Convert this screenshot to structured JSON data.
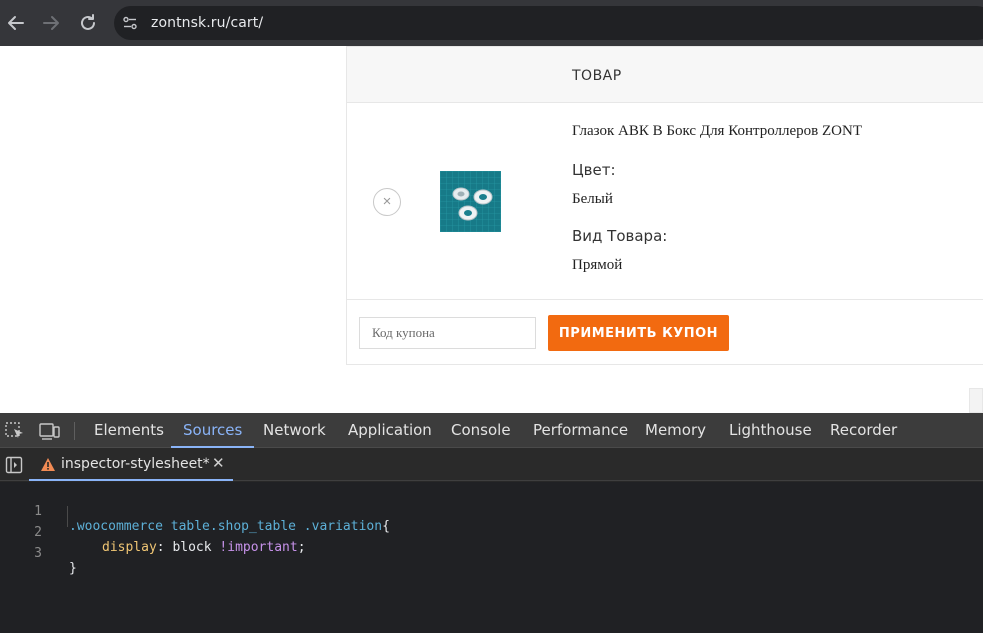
{
  "browser": {
    "url": "zontnsk.ru/cart/",
    "icons": [
      "back-arrow-icon",
      "forward-arrow-icon",
      "reload-icon",
      "site-settings-icon"
    ]
  },
  "cart": {
    "column_header": "ТОВАР",
    "item": {
      "name": "Глазок АВК В Бокс Для Контроллеров ZONT",
      "attributes": [
        {
          "label": "Цвет:",
          "value": "Белый"
        },
        {
          "label": "Вид Товара:",
          "value": "Прямой"
        }
      ],
      "remove_symbol": "×"
    },
    "coupon": {
      "placeholder": "Код купона",
      "button_label": "ПРИМЕНИТЬ КУПОН"
    },
    "colors": {
      "accent": "#f26a10",
      "header_bg": "#f7f7f7"
    }
  },
  "devtools": {
    "tabs": [
      "Elements",
      "Sources",
      "Network",
      "Application",
      "Console",
      "Performance",
      "Memory",
      "Lighthouse",
      "Recorder"
    ],
    "active_tab": "Sources",
    "file": {
      "name": "inspector-stylesheet*",
      "warning_icon": "warning-icon",
      "close_symbol": "✕"
    },
    "code": {
      "line_numbers": [
        "1",
        "2",
        "3"
      ],
      "selector": ".woocommerce table.shop_table .variation",
      "open_brace": "{",
      "property": "display",
      "value": "block",
      "important": "!important",
      "close_brace": "}"
    }
  }
}
